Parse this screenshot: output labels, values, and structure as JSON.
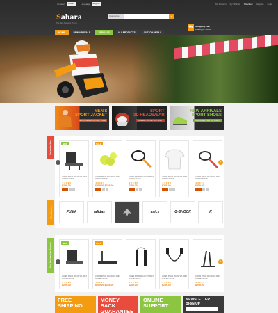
{
  "topbar": {
    "currency_label": "Currency",
    "currency_value": "Dollar",
    "language_label": "Language",
    "language_value": "English",
    "links": [
      "My Account",
      "My Wishlist",
      "Checkout",
      "Register",
      "Login"
    ]
  },
  "logo": {
    "first": "S",
    "rest": "ahara",
    "tagline": "The Best Magento Theme"
  },
  "search": {
    "category": "Categories",
    "placeholder": "",
    "button_icon": "search-icon"
  },
  "cart": {
    "title": "Shopping Cart",
    "summary": "0 item(s) - $0.00"
  },
  "nav": [
    "HOME",
    "NEW ARRIVALS",
    "SPECIALS",
    "ALL PRODUCTS",
    "CUSTOM MENU"
  ],
  "banners": [
    {
      "title1": "MEN'S",
      "title2": "SPORT JACKET",
      "line": "GET IN NEW LOOK ONLY $39.99",
      "sub": ""
    },
    {
      "title1": "SPORT",
      "title2": "3D HEADWEAR",
      "line": "SUMMER COLLECTION 2014",
      "sub": ""
    },
    {
      "title1": "NEW ARRIVALS",
      "title2": "SPORT SHOES",
      "line": "COMING ALL TIME TOP RIGHT",
      "sub": ""
    }
  ],
  "sections": [
    {
      "tab": "Bestseller New"
    },
    {
      "tab": "Manufacturer"
    },
    {
      "tab": "Best Accessories Product"
    }
  ],
  "product_row_1": [
    {
      "badge": "NEW",
      "name": "LOREM IPSUM DOLOR SIT AMET CONSECTETUR",
      "stars": "★★★★★",
      "price": "$259.00"
    },
    {
      "badge": "SALE",
      "name": "LOREM IPSUM DOLOR SIT AMET CONSECTETUR",
      "stars": "★★★★★",
      "price": "$259.00 $239.00"
    },
    {
      "badge": "",
      "name": "LOREM IPSUM DOLOR SIT AMET CONSECTETUR",
      "stars": "★★★★★",
      "price": "$259.00"
    },
    {
      "badge": "",
      "name": "LOREM IPSUM DOLOR SIT AMET CONSECTETUR",
      "stars": "★★★★★",
      "price": "$259.00"
    },
    {
      "badge": "",
      "name": "LOREM IPSUM DOLOR SIT AMET CONSECTETUR",
      "stars": "★★★★★",
      "price": "$259.00"
    }
  ],
  "brands": [
    "PUMA",
    "adidas",
    "",
    "asics",
    "G-SHOCK",
    "K"
  ],
  "product_row_2": [
    {
      "badge": "NEW",
      "name": "LOREM IPSUM DOLOR SIT AMET CONSECTETUR",
      "stars": "★★★★★",
      "price": "$259.00"
    },
    {
      "badge": "SALE",
      "name": "LOREM IPSUM DOLOR SIT AMET CONSECTETUR",
      "stars": "★★★★★",
      "price": "$259.00 $239.00"
    },
    {
      "badge": "",
      "name": "LOREM IPSUM DOLOR SIT AMET CONSECTETUR",
      "stars": "★★★★★",
      "price": "$259.00"
    },
    {
      "badge": "",
      "name": "LOREM IPSUM DOLOR SIT AMET CONSECTETUR",
      "stars": "★★★★★",
      "price": "$259.00"
    },
    {
      "badge": "",
      "name": "LOREM IPSUM DOLOR SIT AMET CONSECTETUR",
      "stars": "★★★★★",
      "price": "$259.00"
    }
  ],
  "promos": [
    {
      "line1": "FREE",
      "line2": "SHIPPING"
    },
    {
      "line1": "MONEY",
      "line2": "BACK GUARANTEE"
    },
    {
      "line1": "ONLINE",
      "line2": "SUPPORT"
    },
    {
      "line1": "NEWSLETTER",
      "line2": "SIGN UP"
    }
  ],
  "colors": {
    "accent": "#f39c12",
    "green": "#8cc540",
    "red": "#e74c3c",
    "dark": "#2b2b2b"
  }
}
